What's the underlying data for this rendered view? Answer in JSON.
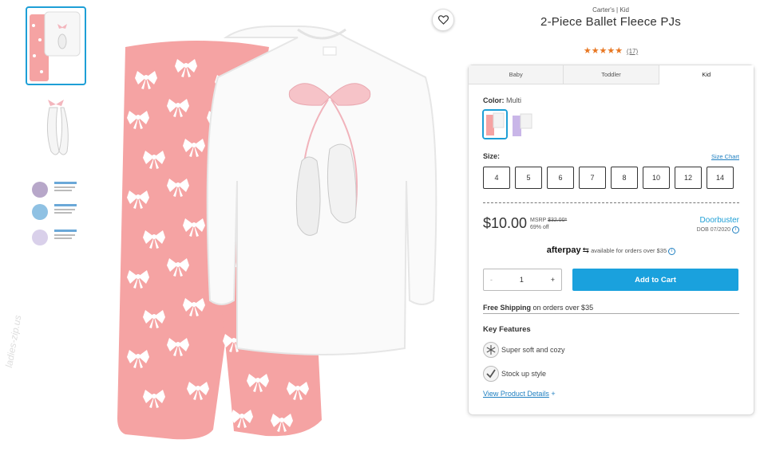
{
  "breadcrumb": "Carter's | Kid",
  "product": {
    "title": "2-Piece Ballet Fleece PJs",
    "stars": "★★★★★",
    "review_count": "(17)",
    "rating": 5
  },
  "tabs": [
    {
      "label": "Baby"
    },
    {
      "label": "Toddler"
    },
    {
      "label": "Kid",
      "active": true
    }
  ],
  "color": {
    "label": "Color:",
    "value": "Multi"
  },
  "size": {
    "label": "Size:",
    "chart_link": "Size Chart",
    "options": [
      "4",
      "5",
      "6",
      "7",
      "8",
      "10",
      "12",
      "14"
    ]
  },
  "pricing": {
    "price": "$10.00",
    "msrp_label": "MSRP",
    "msrp": "$32.00*",
    "discount": "69% off",
    "badge": "Doorbuster",
    "dob": "DOB 07/2020"
  },
  "afterpay": {
    "brand": "afterpay",
    "text": "available for orders over $35"
  },
  "quantity": {
    "minus": "-",
    "value": "1",
    "plus": "+"
  },
  "add_to_cart": "Add to Cart",
  "shipping": {
    "bold": "Free Shipping",
    "rest": "on orders over $35"
  },
  "key_features": {
    "title": "Key Features",
    "items": [
      {
        "icon": "snowflake-icon",
        "text": "Super soft and cozy"
      },
      {
        "icon": "checkmark-icon",
        "text": "Stock up style"
      }
    ]
  },
  "view_details": {
    "label": "View Product Details",
    "plus": "+"
  },
  "watermark": "ladies-zip.us",
  "colors": {
    "accent": "#1aa1dd",
    "star": "#e87722",
    "pants": "#f5a3a3"
  }
}
